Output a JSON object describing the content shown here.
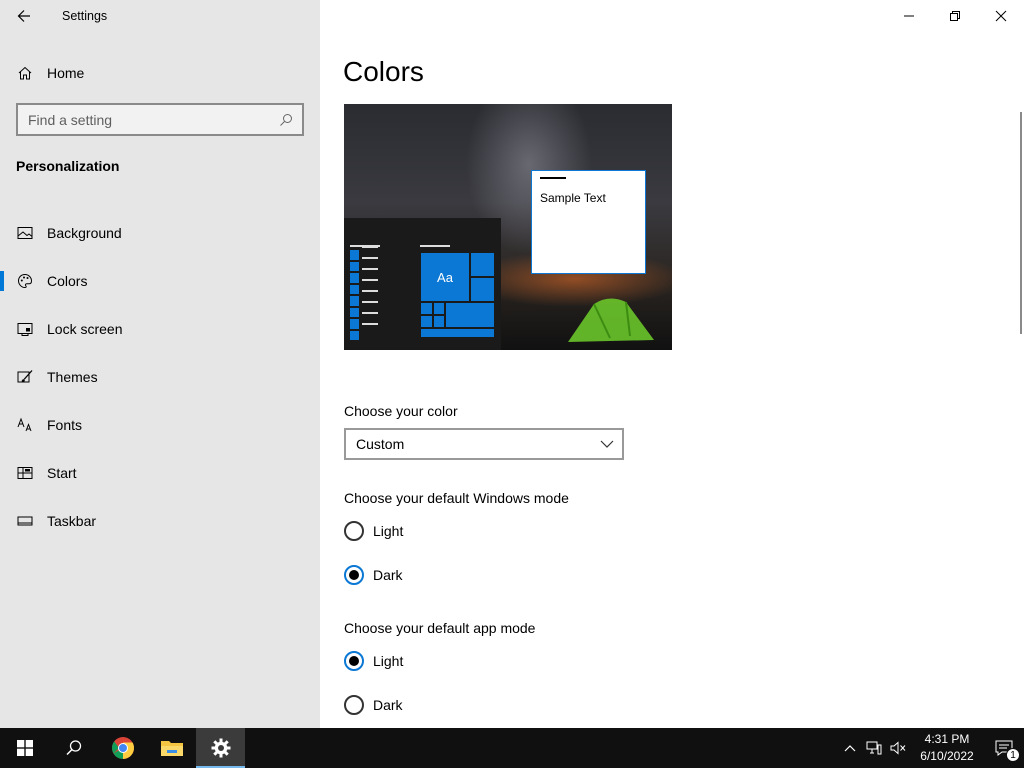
{
  "window": {
    "title": "Settings"
  },
  "sidebar": {
    "home_label": "Home",
    "search": {
      "placeholder": "Find a setting"
    },
    "section": "Personalization",
    "items": [
      {
        "label": "Background",
        "icon": "picture-icon"
      },
      {
        "label": "Colors",
        "icon": "palette-icon",
        "active": true
      },
      {
        "label": "Lock screen",
        "icon": "lock-screen-icon"
      },
      {
        "label": "Themes",
        "icon": "themes-brush-icon"
      },
      {
        "label": "Fonts",
        "icon": "fonts-icon"
      },
      {
        "label": "Start",
        "icon": "start-icon"
      },
      {
        "label": "Taskbar",
        "icon": "taskbar-icon"
      }
    ]
  },
  "main": {
    "title": "Colors",
    "preview": {
      "sample_text": "Sample Text",
      "tile_text": "Aa"
    },
    "choose_color": {
      "label": "Choose your color",
      "value": "Custom"
    },
    "windows_mode": {
      "label": "Choose your default Windows mode",
      "options": [
        "Light",
        "Dark"
      ],
      "selected": "Dark"
    },
    "app_mode": {
      "label": "Choose your default app mode",
      "options": [
        "Light",
        "Dark"
      ],
      "selected": "Light"
    }
  },
  "taskbar": {
    "pinned": [
      "start-icon",
      "search-icon",
      "chrome-icon",
      "file-explorer-icon",
      "settings-gear-icon"
    ],
    "clock": {
      "time": "4:31 PM",
      "date": "6/10/2022"
    },
    "notification_count": "1"
  },
  "colors": {
    "accent": "#0078d7",
    "sidebar_bg": "#e6e6e6",
    "taskbar_bg": "#101010"
  }
}
